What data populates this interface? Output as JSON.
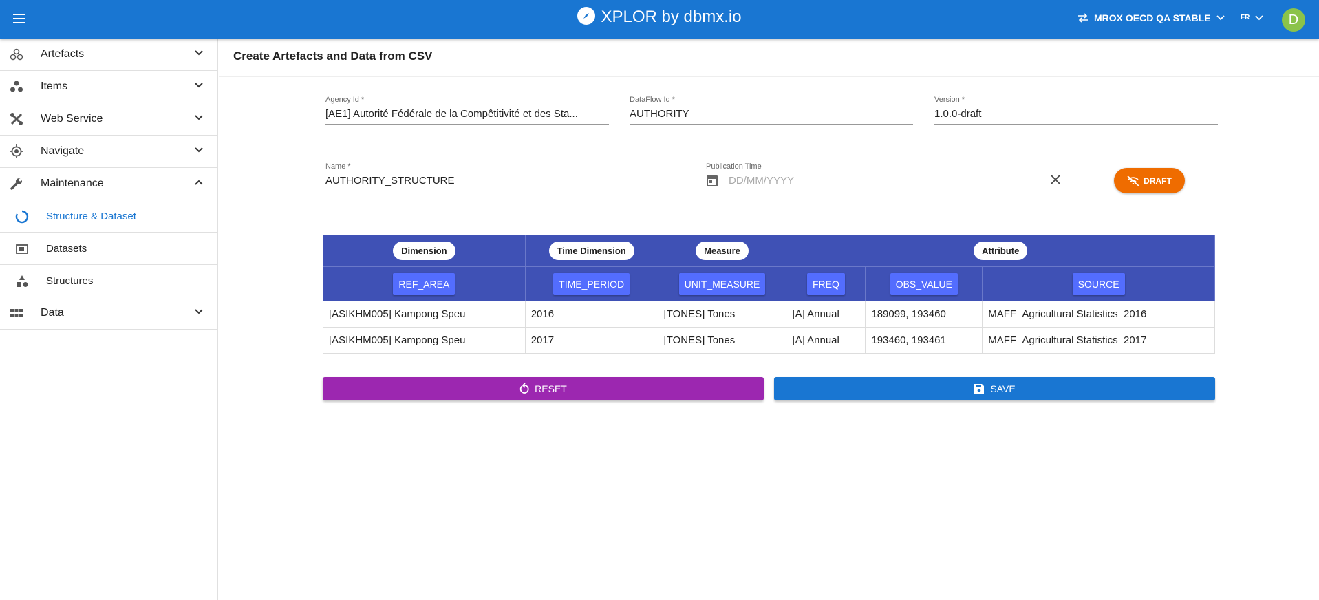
{
  "header": {
    "brand": "XPLOR by dbmx.io",
    "environment": "MROX OECD QA STABLE",
    "language": "FR",
    "avatar_initial": "D",
    "color": "#1976d2"
  },
  "sidebar": {
    "items": [
      {
        "label": "Artefacts",
        "icon": "artefacts-icon"
      },
      {
        "label": "Items",
        "icon": "items-icon"
      },
      {
        "label": "Web Service",
        "icon": "web-service-icon"
      },
      {
        "label": "Navigate",
        "icon": "navigate-icon"
      },
      {
        "label": "Maintenance",
        "icon": "wrench-icon",
        "expanded": true
      },
      {
        "label": "Structure & Dataset",
        "icon": "loading-circle-icon",
        "sub": true,
        "active": true
      },
      {
        "label": "Datasets",
        "icon": "datasets-icon",
        "sub": true
      },
      {
        "label": "Structures",
        "icon": "shapes-icon",
        "sub": true
      },
      {
        "label": "Data",
        "icon": "grid-icon"
      }
    ]
  },
  "page": {
    "title": "Create Artefacts and Data from CSV"
  },
  "form": {
    "agency": {
      "label": "Agency Id *",
      "value": "[AE1] Autorité Fédérale de la Compêtitivité et des Sta..."
    },
    "dataflow": {
      "label": "DataFlow Id *",
      "value": "AUTHORITY"
    },
    "version": {
      "label": "Version *",
      "value": "1.0.0-draft"
    },
    "name": {
      "label": "Name *",
      "value": "AUTHORITY_STRUCTURE"
    },
    "publication": {
      "label": "Publication Time",
      "placeholder": "DD/MM/YYYY"
    },
    "draft_label": "DRAFT"
  },
  "table": {
    "types": [
      "Dimension",
      "Time Dimension",
      "Measure",
      "Attribute"
    ],
    "columns": [
      "REF_AREA",
      "TIME_PERIOD",
      "UNIT_MEASURE",
      "FREQ",
      "OBS_VALUE",
      "SOURCE"
    ],
    "rows": [
      [
        "[ASIKHM005] Kampong Speu",
        "2016",
        "[TONES] Tones",
        "[A] Annual",
        "189099, 193460",
        "MAFF_Agricultural Statistics_2016"
      ],
      [
        "[ASIKHM005] Kampong Speu",
        "2017",
        "[TONES] Tones",
        "[A] Annual",
        "193460, 193461",
        "MAFF_Agricultural Statistics_2017"
      ]
    ]
  },
  "actions": {
    "reset_label": "RESET",
    "save_label": "SAVE"
  }
}
